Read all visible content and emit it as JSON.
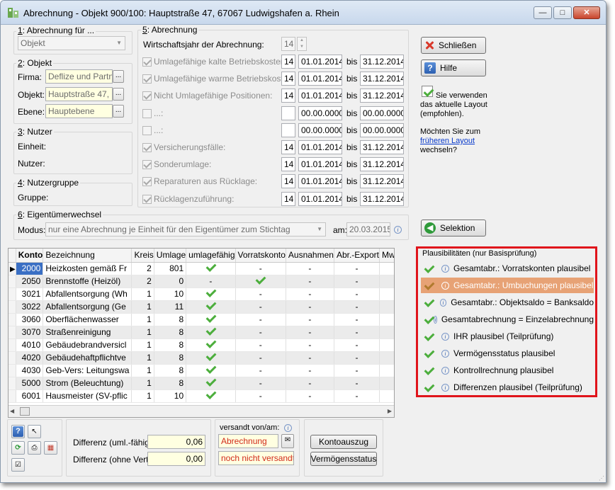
{
  "window": {
    "title": "Abrechnung - Objekt 900/100:  Hauptstraße 47, 67067 Ludwigshafen a. Rhein",
    "minimize": "—",
    "maximize": "□",
    "close": "✕"
  },
  "sec1": {
    "label_prefix": "1",
    "label": ": Abrechnung für ...",
    "select_value": "Objekt"
  },
  "sec2": {
    "label_prefix": "2",
    "label": ": Objekt",
    "firma_label": "Firma:",
    "firma_value": "Deflize und Partne",
    "objekt_label": "Objekt:",
    "objekt_value": "Hauptstraße 47, 67",
    "ebene_label": "Ebene:",
    "ebene_value": "Hauptebene",
    "ellipsis": "..."
  },
  "sec3": {
    "label_prefix": "3",
    "label": ": Nutzer",
    "einheit_label": "Einheit:",
    "nutzer_label": "Nutzer:"
  },
  "sec4": {
    "label_prefix": "4",
    "label": ": Nutzergruppe",
    "gruppe_label": "Gruppe:"
  },
  "sec5": {
    "label_prefix": "5",
    "label": ": Abrechnung",
    "wj_label": "Wirtschaftsjahr der Abrechnung:",
    "wj_value": "14",
    "bis": "bis",
    "rows": [
      {
        "label": "Umlagefähige kalte Betriebskosten:",
        "checked": true,
        "num": "14",
        "from": "01.01.2014",
        "to": "31.12.2014"
      },
      {
        "label": "Umlagefähige warme Betriebskosten:",
        "checked": true,
        "num": "14",
        "from": "01.01.2014",
        "to": "31.12.2014"
      },
      {
        "label": "Nicht Umlagefähige Positionen:",
        "checked": true,
        "num": "14",
        "from": "01.01.2014",
        "to": "31.12.2014"
      },
      {
        "label": "...:",
        "checked": false,
        "num": "",
        "from": "00.00.0000",
        "to": "00.00.0000"
      },
      {
        "label": "...:",
        "checked": false,
        "num": "",
        "from": "00.00.0000",
        "to": "00.00.0000"
      },
      {
        "label": "Versicherungsfälle:",
        "checked": true,
        "num": "14",
        "from": "01.01.2014",
        "to": "31.12.2014"
      },
      {
        "label": "Sonderumlage:",
        "checked": true,
        "num": "14",
        "from": "01.01.2014",
        "to": "31.12.2014"
      },
      {
        "label": "Reparaturen aus Rücklage:",
        "checked": true,
        "num": "14",
        "from": "01.01.2014",
        "to": "31.12.2014"
      },
      {
        "label": "Rücklagenzuführung:",
        "checked": true,
        "num": "14",
        "from": "01.01.2014",
        "to": "31.12.2014"
      }
    ]
  },
  "sec6": {
    "label_prefix": "6",
    "label": ": Eigentümerwechsel",
    "modus_label": "Modus:",
    "modus_value": "nur eine Abrechnung je Einheit für den Eigentümer zum Stichtag",
    "am_label": "am:",
    "am_value": "20.03.2015"
  },
  "buttons": {
    "schliessen": "Schließen",
    "hilfe": "Hilfe",
    "selektion": "Selektion",
    "kontoauszug": "Kontoauszug",
    "vermoegensstatus": "Vermögensstatus"
  },
  "layout_note": {
    "current": "Sie verwenden das aktuelle Layout (empfohlen).",
    "question": "Möchten Sie zum",
    "link": "früheren Layout",
    "suffix": "wechseln?"
  },
  "table": {
    "columns": [
      "Konto",
      "Bezeichnung",
      "Kreis",
      "Umlage",
      "umlagefähig",
      "Vorratskonto",
      "Ausnahmen",
      "Abr.-Export",
      "MwSt"
    ],
    "rows": [
      {
        "konto": "2000",
        "bez": "Heizkosten gemäß Fr",
        "kreis": "2",
        "umlage": "801",
        "uf": "check",
        "vk": "-",
        "aus": "-",
        "exp": "-"
      },
      {
        "konto": "2050",
        "bez": "Brennstoffe (Heizöl)",
        "kreis": "2",
        "umlage": "0",
        "uf": "-",
        "vk": "check",
        "aus": "-",
        "exp": "-"
      },
      {
        "konto": "3021",
        "bez": "Abfallentsorgung (Wh",
        "kreis": "1",
        "umlage": "10",
        "uf": "check",
        "vk": "-",
        "aus": "-",
        "exp": "-"
      },
      {
        "konto": "3022",
        "bez": "Abfallentsorgung (Ge",
        "kreis": "1",
        "umlage": "11",
        "uf": "check",
        "vk": "-",
        "aus": "-",
        "exp": "-"
      },
      {
        "konto": "3060",
        "bez": "Oberflächenwasser",
        "kreis": "1",
        "umlage": "8",
        "uf": "check",
        "vk": "-",
        "aus": "-",
        "exp": "-"
      },
      {
        "konto": "3070",
        "bez": "Straßenreinigung",
        "kreis": "1",
        "umlage": "8",
        "uf": "check",
        "vk": "-",
        "aus": "-",
        "exp": "-"
      },
      {
        "konto": "4010",
        "bez": "Gebäudebrandversicl",
        "kreis": "1",
        "umlage": "8",
        "uf": "check",
        "vk": "-",
        "aus": "-",
        "exp": "-"
      },
      {
        "konto": "4020",
        "bez": "Gebäudehaftpflichtve",
        "kreis": "1",
        "umlage": "8",
        "uf": "check",
        "vk": "-",
        "aus": "-",
        "exp": "-"
      },
      {
        "konto": "4030",
        "bez": "Geb-Vers: Leitungswa",
        "kreis": "1",
        "umlage": "8",
        "uf": "check",
        "vk": "-",
        "aus": "-",
        "exp": "-"
      },
      {
        "konto": "5000",
        "bez": "Strom (Beleuchtung)",
        "kreis": "1",
        "umlage": "8",
        "uf": "check",
        "vk": "-",
        "aus": "-",
        "exp": "-"
      },
      {
        "konto": "6001",
        "bez": "Hausmeister (SV-pflic",
        "kreis": "1",
        "umlage": "10",
        "uf": "check",
        "vk": "-",
        "aus": "-",
        "exp": "-"
      }
    ]
  },
  "plausibility": {
    "title": "Plausibilitäten (nur Basisprüfung)",
    "items": [
      "Gesamtabr.: Vorratskonten plausibel",
      "Gesamtabr.: Umbuchungen plausibel",
      "Gesamtabr.: Objektsaldo = Banksaldo",
      "Gesamtabrechnung = Einzelabrechnung",
      "IHR plausibel (Teilprüfung)",
      "Vermögensstatus plausibel",
      "Kontrollrechnung plausibel",
      "Differenzen plausibel (Teilprüfung)"
    ],
    "highlighted_index": 1
  },
  "bottom": {
    "diff_uml_label": "Differenz (uml.-fähig):",
    "diff_uml_value": "0,06",
    "diff_vert_label": "Differenz (ohne Vert.):",
    "diff_vert_value": "0,00",
    "versandt_label": "versandt von/am:",
    "versandt_by": "Abrechnung",
    "versandt_status": "noch nicht versandt"
  },
  "colors": {
    "highlight": "#e7a275",
    "red_border": "#e0141b",
    "check_green": "#4cae3c",
    "link": "#0a3bcc",
    "red_text": "#d22b1a"
  }
}
